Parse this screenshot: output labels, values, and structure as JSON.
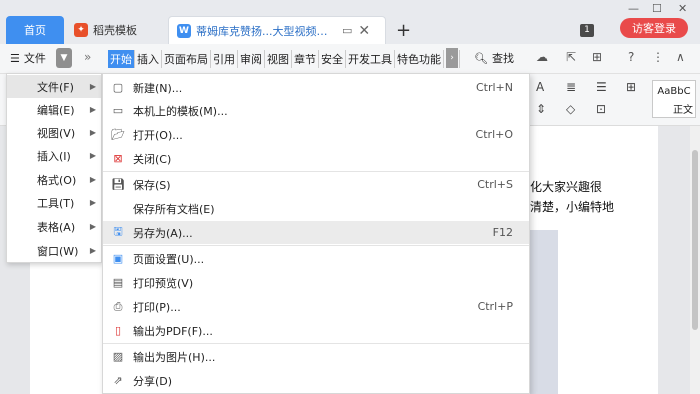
{
  "tabs": {
    "home": "首页",
    "template": "稻壳模板",
    "document": "蒂姆库克赞扬...大型视频壁画"
  },
  "titlebar": {
    "badge": "1",
    "login": "访客登录"
  },
  "ribbon": {
    "menu_label": "文件",
    "tabs": [
      "开始",
      "插入",
      "页面布局",
      "引用",
      "审阅",
      "视图",
      "章节",
      "安全",
      "开发工具",
      "特色功能",
      "文"
    ],
    "find_label": "查找"
  },
  "toolbar": {
    "style_sample": "AaBbC",
    "style_name": "正文"
  },
  "document": {
    "line1": "化大家兴趣很",
    "line2": "清楚，小编特地"
  },
  "main_menu": {
    "items": [
      {
        "label": "文件(F)"
      },
      {
        "label": "编辑(E)"
      },
      {
        "label": "视图(V)"
      },
      {
        "label": "插入(I)"
      },
      {
        "label": "格式(O)"
      },
      {
        "label": "工具(T)"
      },
      {
        "label": "表格(A)"
      },
      {
        "label": "窗口(W)"
      }
    ]
  },
  "file_menu": {
    "items": [
      {
        "label": "新建(N)...",
        "shortcut": "Ctrl+N",
        "icon": "new-doc-icon"
      },
      {
        "label": "本机上的模板(M)...",
        "shortcut": "",
        "icon": "template-icon"
      },
      {
        "label": "打开(O)...",
        "shortcut": "Ctrl+O",
        "icon": "folder-open-icon"
      },
      {
        "label": "关闭(C)",
        "shortcut": "",
        "icon": "close-doc-icon"
      },
      {
        "label": "保存(S)",
        "shortcut": "Ctrl+S",
        "icon": "save-icon"
      },
      {
        "label": "保存所有文档(E)",
        "shortcut": "",
        "icon": ""
      },
      {
        "label": "另存为(A)...",
        "shortcut": "F12",
        "icon": "save-as-icon"
      },
      {
        "label": "页面设置(U)...",
        "shortcut": "",
        "icon": "page-setup-icon"
      },
      {
        "label": "打印预览(V)",
        "shortcut": "",
        "icon": "print-preview-icon"
      },
      {
        "label": "打印(P)...",
        "shortcut": "Ctrl+P",
        "icon": "print-icon"
      },
      {
        "label": "输出为PDF(F)...",
        "shortcut": "",
        "icon": "pdf-icon"
      },
      {
        "label": "输出为图片(H)...",
        "shortcut": "",
        "icon": "image-export-icon"
      },
      {
        "label": "分享(D)",
        "shortcut": "",
        "icon": "share-icon"
      }
    ]
  }
}
